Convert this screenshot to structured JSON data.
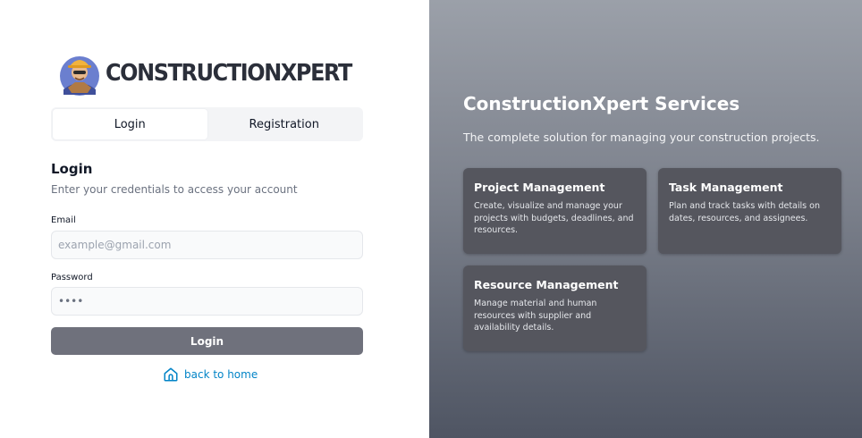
{
  "brand": {
    "name": "CONSTRUCTIONXPERT",
    "logo_icon": "construction-worker-logo"
  },
  "tabs": [
    {
      "label": "Login",
      "active": true
    },
    {
      "label": "Registration",
      "active": false
    }
  ],
  "form": {
    "title": "Login",
    "subtitle": "Enter your credentials to access your account",
    "email_label": "Email",
    "email_placeholder": "example@gmail.com",
    "email_value": "",
    "password_label": "Password",
    "password_value": "••••",
    "submit_label": "Login"
  },
  "back_link": {
    "label": "back to home",
    "icon": "home-icon",
    "color": "#0284c7"
  },
  "services": {
    "title": "ConstructionXpert Services",
    "subtitle": "The complete solution for managing your construction projects.",
    "cards": [
      {
        "title": "Project Management",
        "description": "Create, visualize and manage your projects with budgets, deadlines, and resources."
      },
      {
        "title": "Task Management",
        "description": "Plan and track tasks with details on dates, resources, and assignees."
      },
      {
        "title": "Resource Management",
        "description": "Manage material and human resources with supplier and availability details."
      }
    ]
  },
  "colors": {
    "button": "#6f717c",
    "card": "#55565e",
    "panel_top": "#9ba0a9",
    "panel_bottom": "#4f5563"
  }
}
